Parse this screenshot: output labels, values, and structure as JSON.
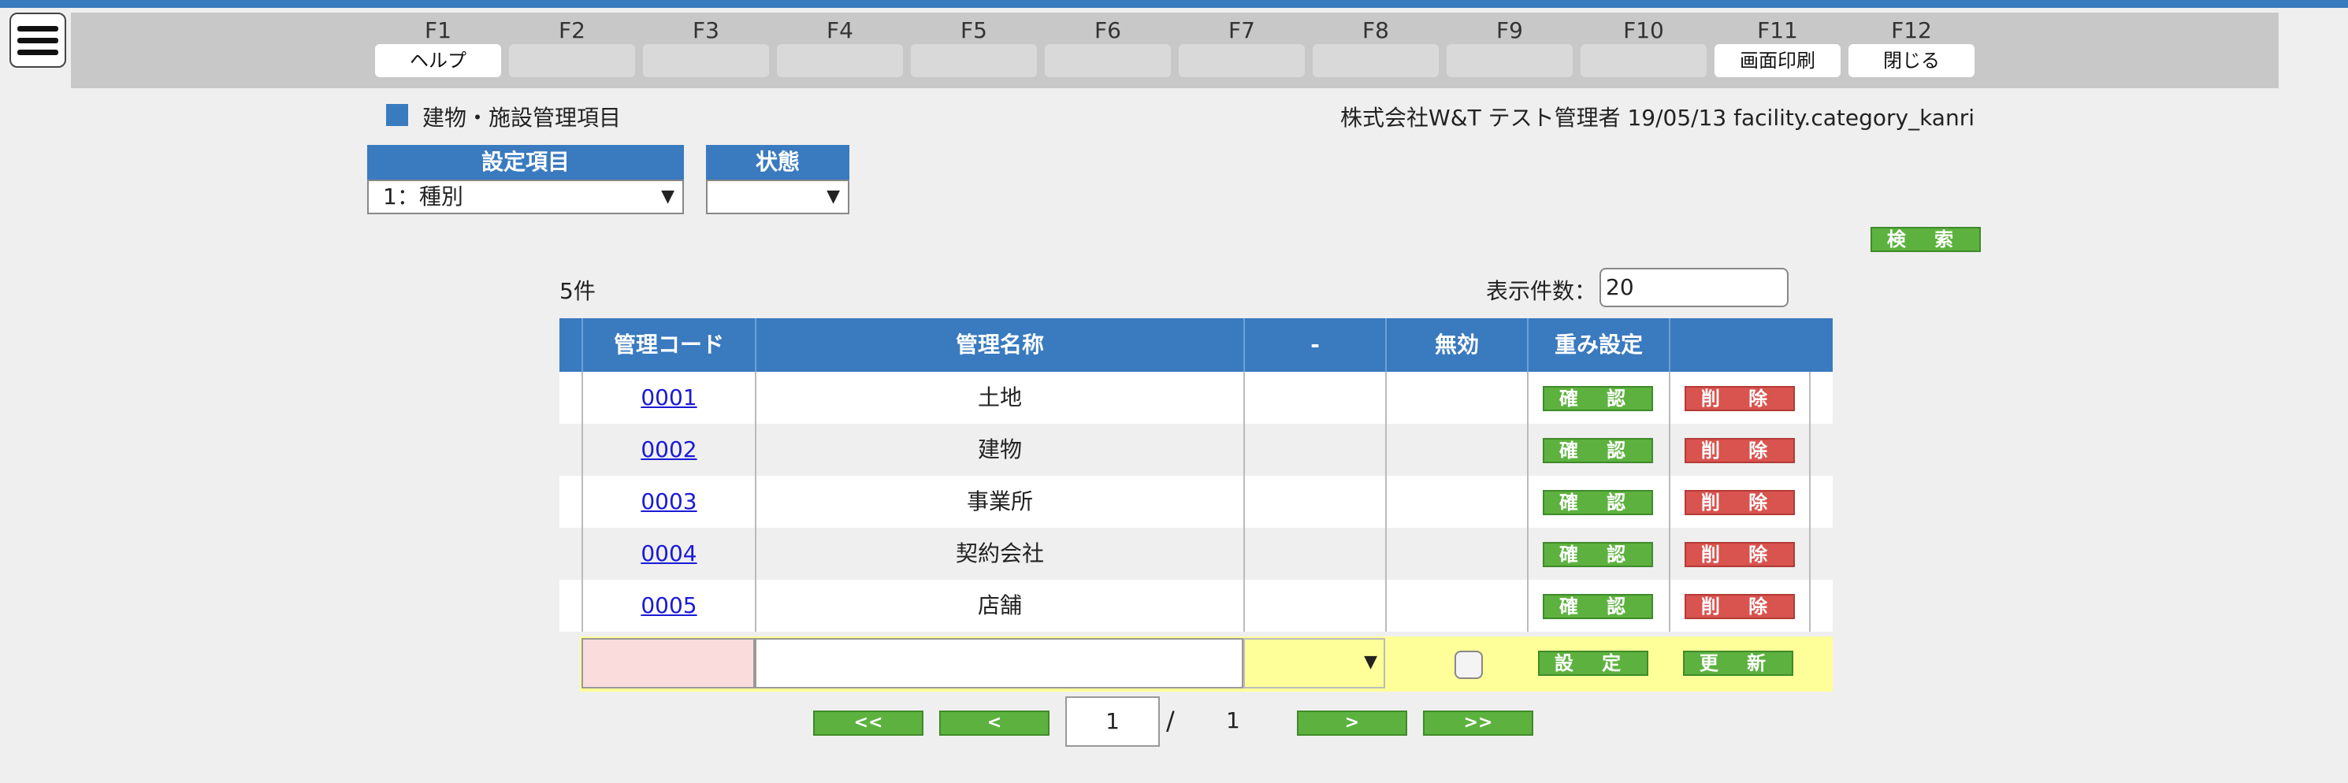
{
  "header": {
    "title": "建物・施設管理項目",
    "info": "株式会社W&T テスト管理者 19/05/13 facility.category_kanri"
  },
  "fkeys": [
    {
      "num": "F1",
      "label": "ヘルプ"
    },
    {
      "num": "F2",
      "label": ""
    },
    {
      "num": "F3",
      "label": ""
    },
    {
      "num": "F4",
      "label": ""
    },
    {
      "num": "F5",
      "label": ""
    },
    {
      "num": "F6",
      "label": ""
    },
    {
      "num": "F7",
      "label": ""
    },
    {
      "num": "F8",
      "label": ""
    },
    {
      "num": "F9",
      "label": ""
    },
    {
      "num": "F10",
      "label": ""
    },
    {
      "num": "F11",
      "label": "画面印刷"
    },
    {
      "num": "F12",
      "label": "閉じる"
    }
  ],
  "filters": {
    "setting_label": "設定項目",
    "setting_value": "1：種別",
    "status_label": "状態",
    "status_value": ""
  },
  "search_label": "検 索",
  "count": "5件",
  "display_count_label": "表示件数：",
  "display_count_value": "20",
  "table": {
    "headers": [
      "管理コード",
      "管理名称",
      "-",
      "無効",
      "重み設定",
      ""
    ],
    "rows": [
      {
        "code": "0001",
        "name": "土地",
        "col3": "",
        "invalid": "",
        "confirm": "確 認",
        "delete": "削 除"
      },
      {
        "code": "0002",
        "name": "建物",
        "col3": "",
        "invalid": "",
        "confirm": "確 認",
        "delete": "削 除"
      },
      {
        "code": "0003",
        "name": "事業所",
        "col3": "",
        "invalid": "",
        "confirm": "確 認",
        "delete": "削 除"
      },
      {
        "code": "0004",
        "name": "契約会社",
        "col3": "",
        "invalid": "",
        "confirm": "確 認",
        "delete": "削 除"
      },
      {
        "code": "0005",
        "name": "店舗",
        "col3": "",
        "invalid": "",
        "confirm": "確 認",
        "delete": "削 除"
      }
    ],
    "new_row": {
      "set": "設 定",
      "update": "更 新"
    }
  },
  "pager": {
    "first": "<<",
    "prev": "<",
    "current": "1",
    "slash": "/",
    "total": "1",
    "next": ">",
    "last": ">>"
  }
}
